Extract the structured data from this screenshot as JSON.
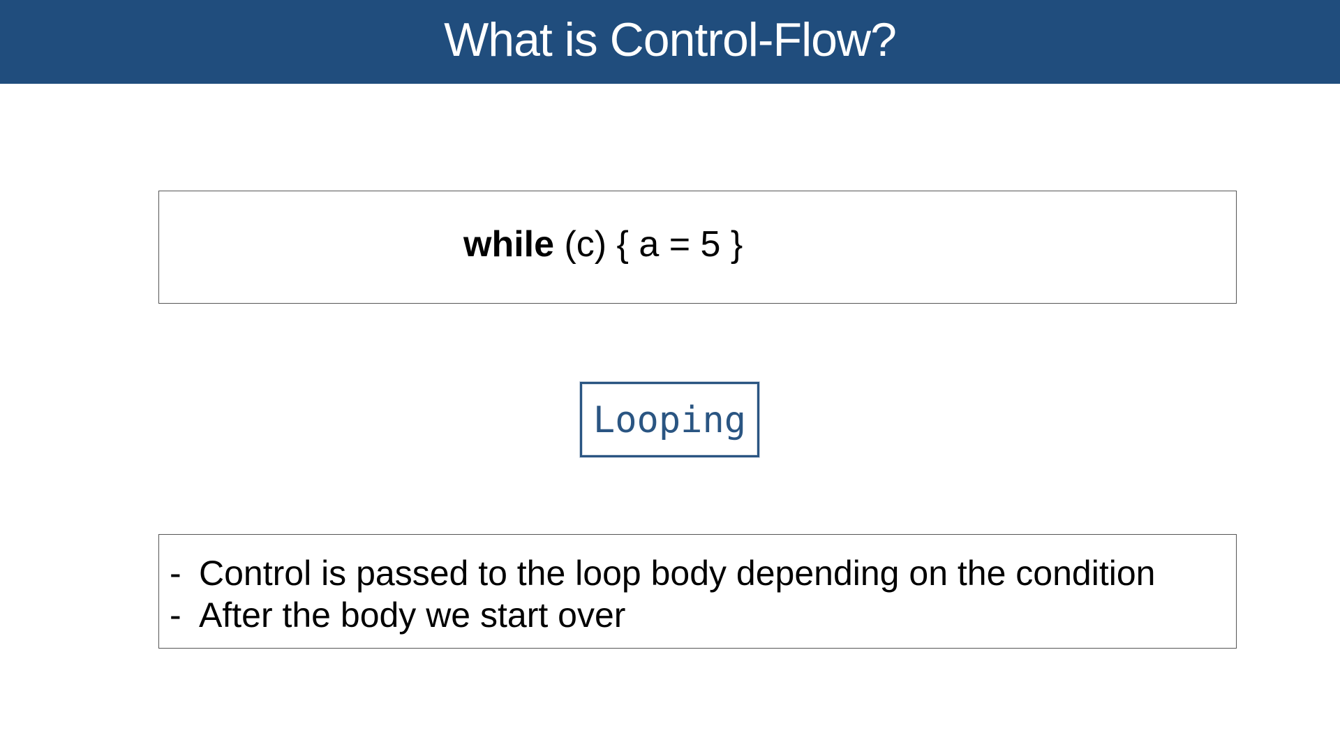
{
  "slide": {
    "title": "What is Control-Flow?"
  },
  "code": {
    "keyword": "while",
    "rest": " (c) { a = 5 }"
  },
  "stamp": {
    "label": "Looping"
  },
  "notes": [
    {
      "dash": "-",
      "text": "Control is passed to the loop body depending on the condition"
    },
    {
      "dash": "-",
      "text": "After the body we start over"
    }
  ],
  "colors": {
    "title_bar": "#204d7d",
    "stamp": "#2a5582"
  }
}
